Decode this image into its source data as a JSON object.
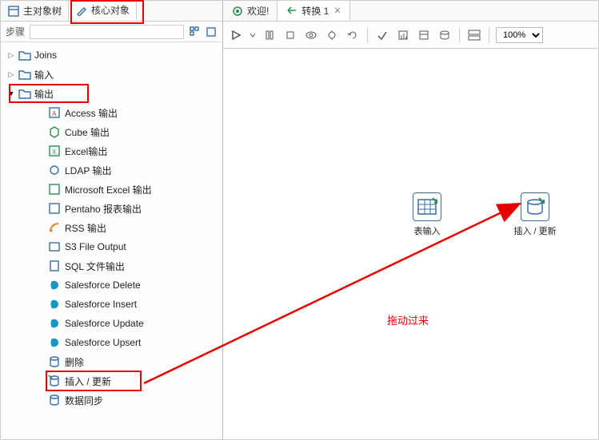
{
  "left_tabs": {
    "main_tree": "主对象树",
    "core_objects": "核心对象"
  },
  "search": {
    "label": "步骤",
    "value": ""
  },
  "tree": {
    "joins": "Joins",
    "input": "输入",
    "output": "输出",
    "children": [
      "Access 输出",
      "Cube 输出",
      "Excel输出",
      "LDAP 输出",
      "Microsoft Excel 输出",
      "Pentaho 报表输出",
      "RSS 输出",
      "S3 File Output",
      "SQL 文件输出",
      "Salesforce Delete",
      "Salesforce Insert",
      "Salesforce Update",
      "Salesforce Upsert",
      "删除",
      "插入 / 更新",
      "数据同步"
    ]
  },
  "editor_tabs": {
    "welcome": "欢迎!",
    "transform": "转换 1"
  },
  "toolbar": {
    "zoom": "100%"
  },
  "canvas": {
    "node1": "表输入",
    "node2": "插入 / 更新"
  },
  "annotation": "拖动过来"
}
